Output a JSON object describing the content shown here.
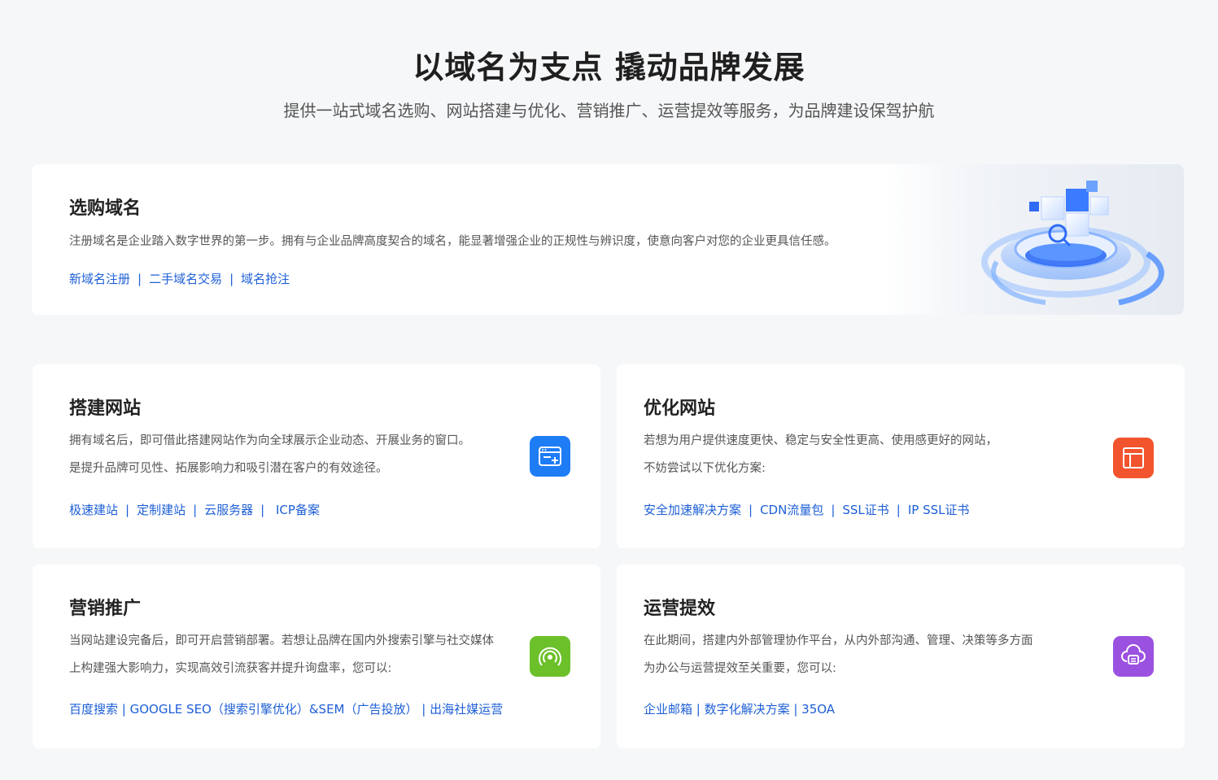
{
  "hero": {
    "title": "以域名为支点 撬动品牌发展",
    "subtitle": "提供一站式域名选购、网站搭建与优化、营销推广、运营提效等服务，为品牌建设保驾护航"
  },
  "cards": {
    "domain": {
      "title": "选购域名",
      "desc": "注册域名是企业踏入数字世界的第一步。拥有与企业品牌高度契合的域名，能显著增强企业的正规性与辨识度，使意向客户对您的企业更具信任感。",
      "links": [
        "新域名注册",
        "二手域名交易",
        "域名抢注"
      ]
    },
    "build": {
      "title": "搭建网站",
      "desc1": "拥有域名后，即可借此搭建网站作为向全球展示企业动态、开展业务的窗口。",
      "desc2": "是提升品牌可见性、拓展影响力和吸引潜在客户的有效途径。",
      "links": [
        "极速建站",
        "定制建站",
        "云服务器",
        " ICP备案"
      ],
      "icon": "browser-add-icon",
      "color": "#1e7cf5"
    },
    "optimize": {
      "title": "优化网站",
      "desc1": "若想为用户提供速度更快、稳定与安全性更高、使用感更好的网站，",
      "desc2": "不妨尝试以下优化方案:",
      "links": [
        "安全加速解决方案",
        "CDN流量包",
        "SSL证书",
        "IP SSL证书"
      ],
      "icon": "layout-icon",
      "color": "#f2542d"
    },
    "marketing": {
      "title": "营销推广",
      "desc1": "当网站建设完备后，即可开启营销部署。若想让品牌在国内外搜索引擎与社交媒体",
      "desc2": "上构建强大影响力，实现高效引流获客并提升询盘率，您可以:",
      "links_text": "百度搜索 | GOOGLE SEO（搜索引擎优化）&SEM（广告投放） | 出海社媒运营",
      "icon": "signal-icon",
      "color": "#6cc12a"
    },
    "operations": {
      "title": "运营提效",
      "desc1": "在此期间，搭建内外部管理协作平台，从内外部沟通、管理、决策等多方面",
      "desc2": "为办公与运营提效至关重要，您可以:",
      "links_text": "企业邮箱 | 数字化解决方案 | 35OA",
      "icon": "cloud-server-icon",
      "color": "#9b51e0"
    }
  }
}
